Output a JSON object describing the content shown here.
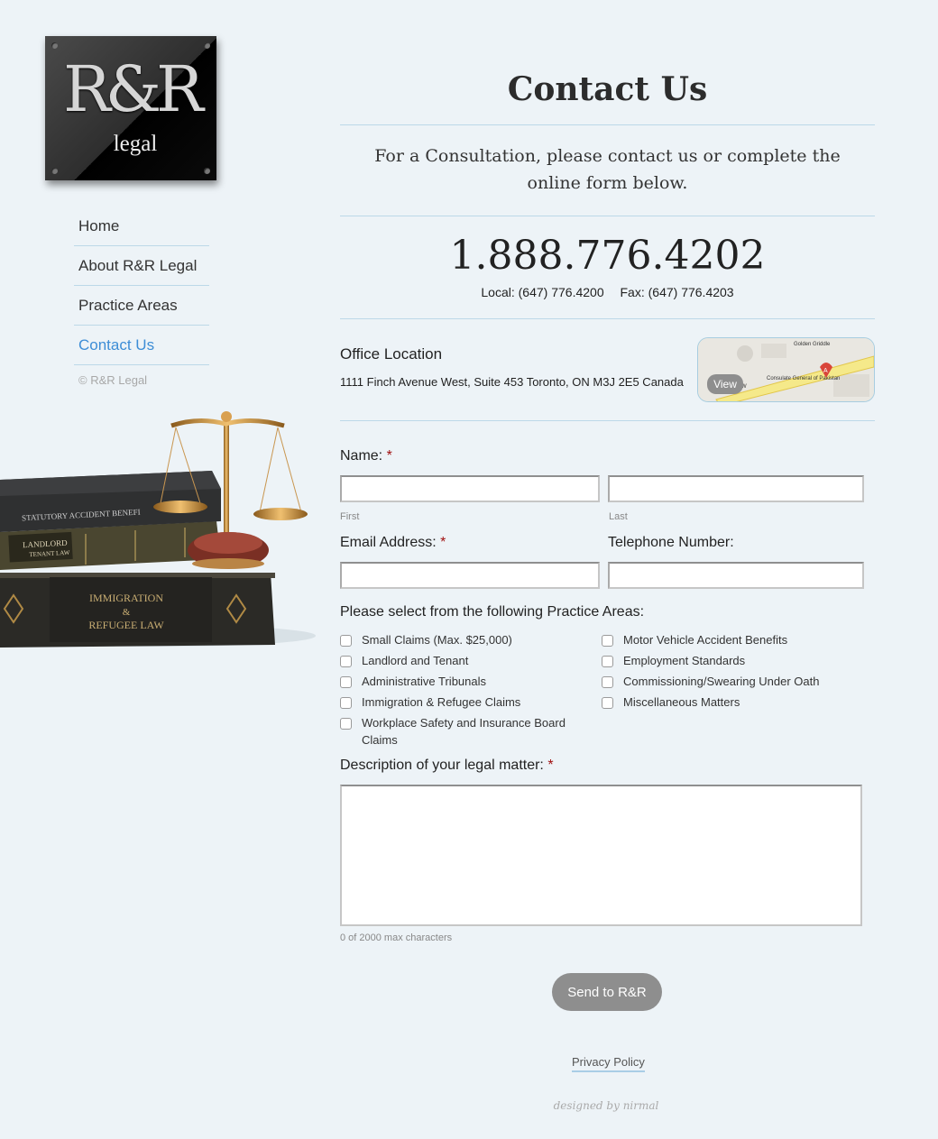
{
  "brand": {
    "monogram": "R&R",
    "sub": "legal"
  },
  "nav": {
    "items": [
      {
        "label": "Home"
      },
      {
        "label": "About R&R Legal"
      },
      {
        "label": "Practice Areas"
      },
      {
        "label": "Contact Us"
      }
    ],
    "active": "Contact Us",
    "copyright": "© R&R Legal"
  },
  "colors": {
    "accent": "#3d8dd6",
    "rule": "#bcd8e8",
    "button": "#8e8e8e",
    "required": "#a01010"
  },
  "page": {
    "title": "Contact Us",
    "intro": "For a Consultation, please contact us or complete the online form below.",
    "phone": "1.888.776.4202",
    "local": "Local: (647) 776.4200",
    "fax": "Fax: (647) 776.4203"
  },
  "office": {
    "heading": "Office Location",
    "address": "1111 Finch Avenue West, Suite 453 Toronto, ON M3J 2E5 Canada",
    "map_view_label": "View",
    "map_labels": [
      "Golden Griddle",
      "Consulate General of Pakistan",
      "ve W"
    ]
  },
  "form": {
    "name_label": "Name:",
    "first_hint": "First",
    "last_hint": "Last",
    "email_label": "Email Address:",
    "phone_label": "Telephone Number:",
    "required_mark": "*",
    "areas_label": "Please select from the following Practice Areas:",
    "areas_left": [
      "Small Claims (Max. $25,000)",
      "Landlord and Tenant",
      "Administrative Tribunals",
      "Immigration & Refugee Claims",
      "Workplace Safety and Insurance Board Claims"
    ],
    "areas_right": [
      "Motor Vehicle Accident Benefits",
      "Employment Standards",
      "Commissioning/Swearing Under Oath",
      "Miscellaneous Matters"
    ],
    "description_label": "Description of your legal matter:",
    "char_count": "0 of 2000 max characters",
    "submit": "Send to R&R"
  },
  "footer": {
    "privacy": "Privacy Policy",
    "designed": "designed by nirmal"
  },
  "books": [
    "STATUTORY ACCIDENT BENEFI",
    "LANDLORD TENANT LAW",
    "IMMIGRATION & REFUGEE LAW"
  ]
}
